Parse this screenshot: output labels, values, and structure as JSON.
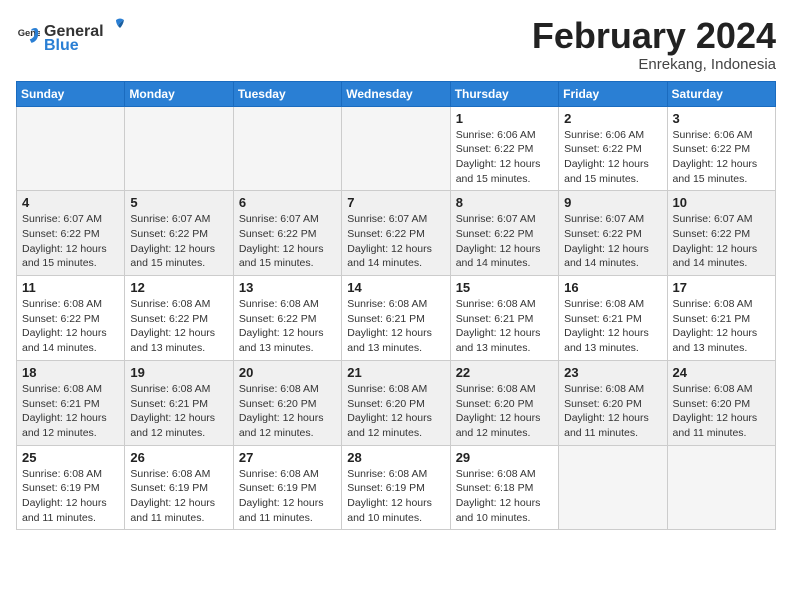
{
  "header": {
    "logo_general": "General",
    "logo_blue": "Blue",
    "month_title": "February 2024",
    "location": "Enrekang, Indonesia"
  },
  "weekdays": [
    "Sunday",
    "Monday",
    "Tuesday",
    "Wednesday",
    "Thursday",
    "Friday",
    "Saturday"
  ],
  "weeks": [
    [
      {
        "day": "",
        "info": ""
      },
      {
        "day": "",
        "info": ""
      },
      {
        "day": "",
        "info": ""
      },
      {
        "day": "",
        "info": ""
      },
      {
        "day": "1",
        "info": "Sunrise: 6:06 AM\nSunset: 6:22 PM\nDaylight: 12 hours\nand 15 minutes."
      },
      {
        "day": "2",
        "info": "Sunrise: 6:06 AM\nSunset: 6:22 PM\nDaylight: 12 hours\nand 15 minutes."
      },
      {
        "day": "3",
        "info": "Sunrise: 6:06 AM\nSunset: 6:22 PM\nDaylight: 12 hours\nand 15 minutes."
      }
    ],
    [
      {
        "day": "4",
        "info": "Sunrise: 6:07 AM\nSunset: 6:22 PM\nDaylight: 12 hours\nand 15 minutes."
      },
      {
        "day": "5",
        "info": "Sunrise: 6:07 AM\nSunset: 6:22 PM\nDaylight: 12 hours\nand 15 minutes."
      },
      {
        "day": "6",
        "info": "Sunrise: 6:07 AM\nSunset: 6:22 PM\nDaylight: 12 hours\nand 15 minutes."
      },
      {
        "day": "7",
        "info": "Sunrise: 6:07 AM\nSunset: 6:22 PM\nDaylight: 12 hours\nand 14 minutes."
      },
      {
        "day": "8",
        "info": "Sunrise: 6:07 AM\nSunset: 6:22 PM\nDaylight: 12 hours\nand 14 minutes."
      },
      {
        "day": "9",
        "info": "Sunrise: 6:07 AM\nSunset: 6:22 PM\nDaylight: 12 hours\nand 14 minutes."
      },
      {
        "day": "10",
        "info": "Sunrise: 6:07 AM\nSunset: 6:22 PM\nDaylight: 12 hours\nand 14 minutes."
      }
    ],
    [
      {
        "day": "11",
        "info": "Sunrise: 6:08 AM\nSunset: 6:22 PM\nDaylight: 12 hours\nand 14 minutes."
      },
      {
        "day": "12",
        "info": "Sunrise: 6:08 AM\nSunset: 6:22 PM\nDaylight: 12 hours\nand 13 minutes."
      },
      {
        "day": "13",
        "info": "Sunrise: 6:08 AM\nSunset: 6:22 PM\nDaylight: 12 hours\nand 13 minutes."
      },
      {
        "day": "14",
        "info": "Sunrise: 6:08 AM\nSunset: 6:21 PM\nDaylight: 12 hours\nand 13 minutes."
      },
      {
        "day": "15",
        "info": "Sunrise: 6:08 AM\nSunset: 6:21 PM\nDaylight: 12 hours\nand 13 minutes."
      },
      {
        "day": "16",
        "info": "Sunrise: 6:08 AM\nSunset: 6:21 PM\nDaylight: 12 hours\nand 13 minutes."
      },
      {
        "day": "17",
        "info": "Sunrise: 6:08 AM\nSunset: 6:21 PM\nDaylight: 12 hours\nand 13 minutes."
      }
    ],
    [
      {
        "day": "18",
        "info": "Sunrise: 6:08 AM\nSunset: 6:21 PM\nDaylight: 12 hours\nand 12 minutes."
      },
      {
        "day": "19",
        "info": "Sunrise: 6:08 AM\nSunset: 6:21 PM\nDaylight: 12 hours\nand 12 minutes."
      },
      {
        "day": "20",
        "info": "Sunrise: 6:08 AM\nSunset: 6:20 PM\nDaylight: 12 hours\nand 12 minutes."
      },
      {
        "day": "21",
        "info": "Sunrise: 6:08 AM\nSunset: 6:20 PM\nDaylight: 12 hours\nand 12 minutes."
      },
      {
        "day": "22",
        "info": "Sunrise: 6:08 AM\nSunset: 6:20 PM\nDaylight: 12 hours\nand 12 minutes."
      },
      {
        "day": "23",
        "info": "Sunrise: 6:08 AM\nSunset: 6:20 PM\nDaylight: 12 hours\nand 11 minutes."
      },
      {
        "day": "24",
        "info": "Sunrise: 6:08 AM\nSunset: 6:20 PM\nDaylight: 12 hours\nand 11 minutes."
      }
    ],
    [
      {
        "day": "25",
        "info": "Sunrise: 6:08 AM\nSunset: 6:19 PM\nDaylight: 12 hours\nand 11 minutes."
      },
      {
        "day": "26",
        "info": "Sunrise: 6:08 AM\nSunset: 6:19 PM\nDaylight: 12 hours\nand 11 minutes."
      },
      {
        "day": "27",
        "info": "Sunrise: 6:08 AM\nSunset: 6:19 PM\nDaylight: 12 hours\nand 11 minutes."
      },
      {
        "day": "28",
        "info": "Sunrise: 6:08 AM\nSunset: 6:19 PM\nDaylight: 12 hours\nand 10 minutes."
      },
      {
        "day": "29",
        "info": "Sunrise: 6:08 AM\nSunset: 6:18 PM\nDaylight: 12 hours\nand 10 minutes."
      },
      {
        "day": "",
        "info": ""
      },
      {
        "day": "",
        "info": ""
      }
    ]
  ]
}
